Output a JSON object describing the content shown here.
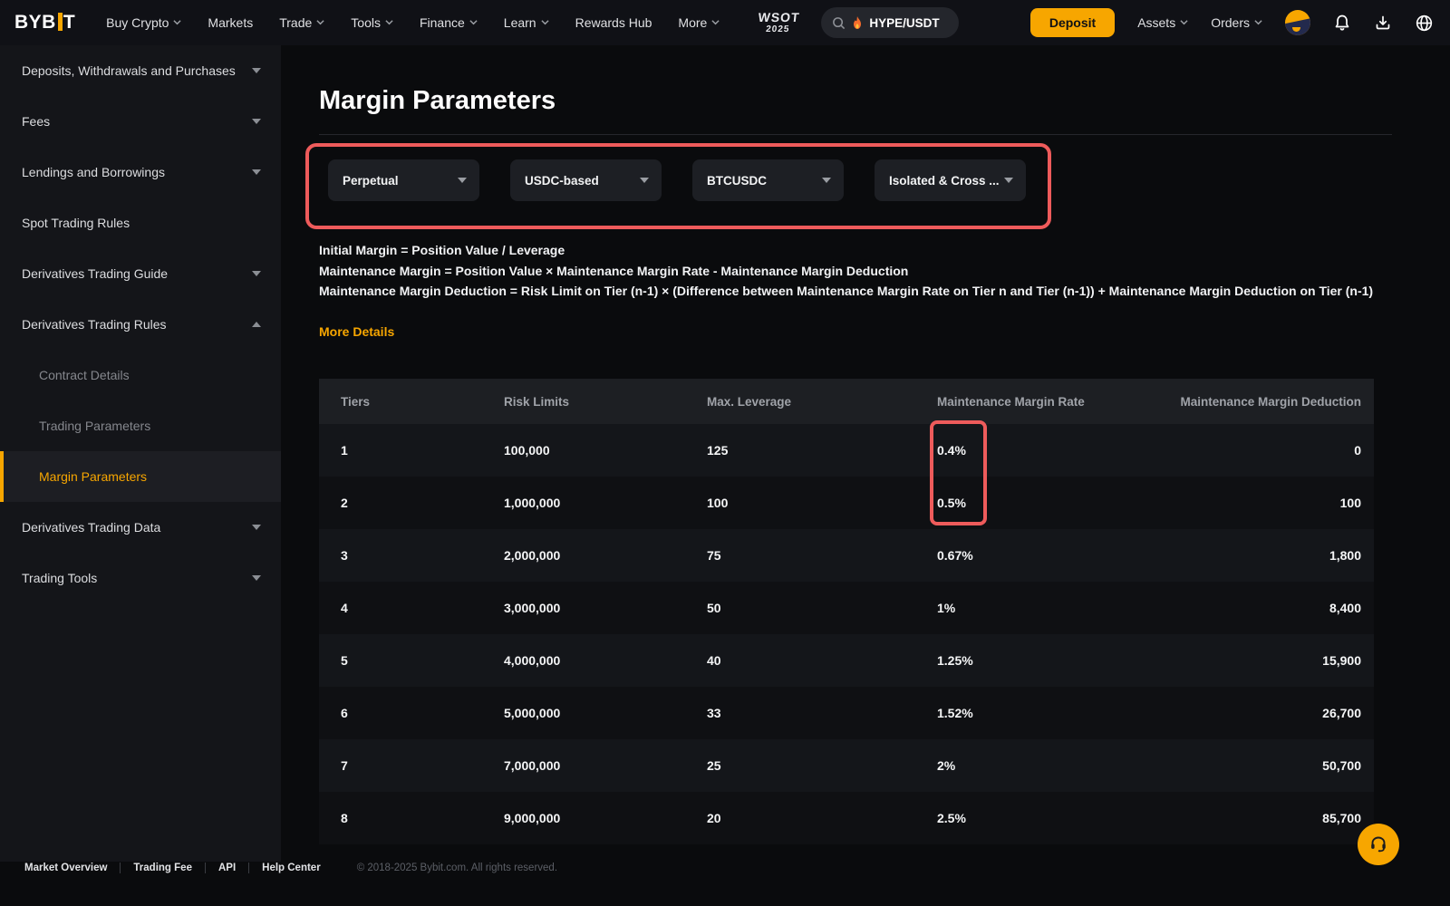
{
  "colors": {
    "accent": "#f7a600",
    "annotation": "#ee5b5b"
  },
  "nav": {
    "logo": {
      "part1": "BYB",
      "part2": "T"
    },
    "items": [
      {
        "label": "Buy Crypto",
        "chevron": true
      },
      {
        "label": "Markets",
        "chevron": false
      },
      {
        "label": "Trade",
        "chevron": true
      },
      {
        "label": "Tools",
        "chevron": true
      },
      {
        "label": "Finance",
        "chevron": true
      },
      {
        "label": "Learn",
        "chevron": true
      },
      {
        "label": "Rewards Hub",
        "chevron": false
      },
      {
        "label": "More",
        "chevron": true
      }
    ],
    "wsot": {
      "line1": "WSOT",
      "line2": "2025"
    },
    "search": {
      "value": "HYPE/USDT"
    },
    "deposit_label": "Deposit",
    "assets_label": "Assets",
    "orders_label": "Orders"
  },
  "sidebar": {
    "items": [
      {
        "label": "Deposits, Withdrawals and Purchases"
      },
      {
        "label": "Fees"
      },
      {
        "label": "Lendings and Borrowings"
      },
      {
        "label": "Spot Trading Rules"
      },
      {
        "label": "Derivatives Trading Guide"
      },
      {
        "label": "Derivatives Trading Rules"
      },
      {
        "label": "Derivatives Trading Data"
      },
      {
        "label": "Trading Tools"
      }
    ],
    "sub_items": [
      {
        "label": "Contract Details"
      },
      {
        "label": "Trading Parameters"
      },
      {
        "label": "Margin Parameters"
      }
    ]
  },
  "main": {
    "title": "Margin Parameters",
    "dropdowns": [
      {
        "value": "Perpetual"
      },
      {
        "value": "USDC-based"
      },
      {
        "value": "BTCUSDC"
      },
      {
        "value": "Isolated & Cross ..."
      }
    ],
    "formulas": [
      "Initial Margin = Position Value / Leverage",
      "Maintenance Margin = Position Value × Maintenance Margin Rate - Maintenance Margin Deduction",
      "Maintenance Margin Deduction = Risk Limit on Tier (n-1) × (Difference between Maintenance Margin Rate on Tier n and Tier (n-1)) + Maintenance Margin Deduction on Tier (n-1)"
    ],
    "more_details_label": "More Details",
    "table": {
      "headers": [
        "Tiers",
        "Risk Limits",
        "Max. Leverage",
        "Maintenance Margin Rate",
        "Maintenance Margin Deduction"
      ],
      "rows": [
        {
          "tier": "1",
          "risk_limit": "100,000",
          "max_leverage": "125",
          "mmr": "0.4%",
          "mmd": "0"
        },
        {
          "tier": "2",
          "risk_limit": "1,000,000",
          "max_leverage": "100",
          "mmr": "0.5%",
          "mmd": "100"
        },
        {
          "tier": "3",
          "risk_limit": "2,000,000",
          "max_leverage": "75",
          "mmr": "0.67%",
          "mmd": "1,800"
        },
        {
          "tier": "4",
          "risk_limit": "3,000,000",
          "max_leverage": "50",
          "mmr": "1%",
          "mmd": "8,400"
        },
        {
          "tier": "5",
          "risk_limit": "4,000,000",
          "max_leverage": "40",
          "mmr": "1.25%",
          "mmd": "15,900"
        },
        {
          "tier": "6",
          "risk_limit": "5,000,000",
          "max_leverage": "33",
          "mmr": "1.52%",
          "mmd": "26,700"
        },
        {
          "tier": "7",
          "risk_limit": "7,000,000",
          "max_leverage": "25",
          "mmr": "2%",
          "mmd": "50,700"
        },
        {
          "tier": "8",
          "risk_limit": "9,000,000",
          "max_leverage": "20",
          "mmr": "2.5%",
          "mmd": "85,700"
        }
      ]
    }
  },
  "footer": {
    "links": [
      "Market Overview",
      "Trading Fee",
      "API",
      "Help Center"
    ],
    "copyright": "© 2018-2025 Bybit.com. All rights reserved."
  }
}
